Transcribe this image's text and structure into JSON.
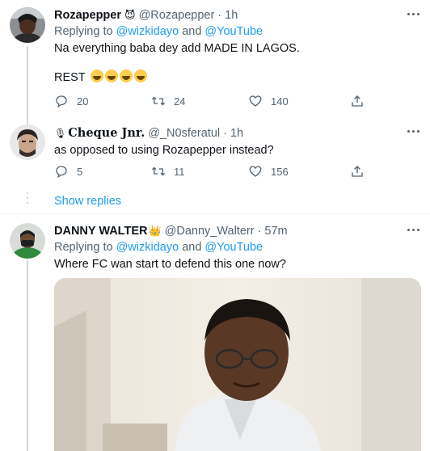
{
  "tweets": [
    {
      "name": "Rozapepper",
      "name_badge": "😈",
      "handle": "@Rozapepper",
      "time": "1h",
      "replying_label": "Replying to",
      "replying_users": [
        "@wizkidayo",
        "@YouTube"
      ],
      "replying_and": "and",
      "lines": [
        "Na everything baba dey add MADE IN LAGOS.",
        "REST"
      ],
      "emoji_count": 4,
      "replies": "20",
      "retweets": "24",
      "likes": "140"
    },
    {
      "name": "Cheque Jnr.",
      "name_prefix": "🎙",
      "handle": "@_N0sferatul",
      "time": "1h",
      "lines": [
        "as opposed to using Rozapepper instead?"
      ],
      "replies": "5",
      "retweets": "11",
      "likes": "156"
    },
    {
      "name": "DANNY WALTER",
      "name_badge": "👑",
      "handle": "@Danny_Walterr",
      "time": "57m",
      "replying_label": "Replying to",
      "replying_users": [
        "@wizkidayo",
        "@YouTube"
      ],
      "replying_and": "and",
      "lines": [
        "Where FC wan start to defend this one now?"
      ]
    }
  ],
  "show_replies": "Show replies",
  "icons": {
    "reply": "reply-icon",
    "retweet": "retweet-icon",
    "like": "heart-icon",
    "share": "share-icon",
    "more": "more-icon"
  },
  "colors": {
    "accent": "#1d9bf0",
    "secondary": "#536471",
    "divider": "#eff3f4"
  }
}
